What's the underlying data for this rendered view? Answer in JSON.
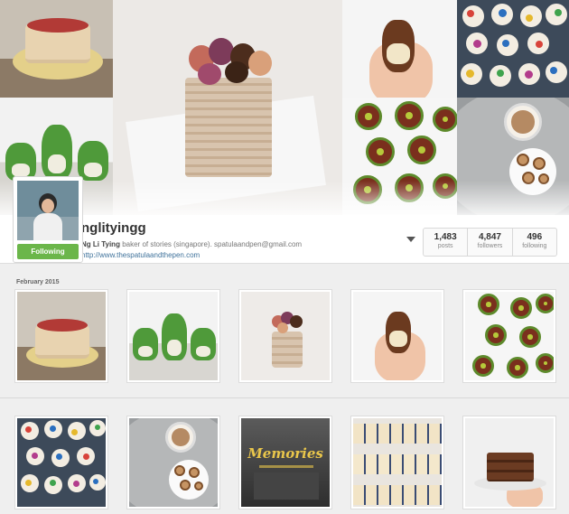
{
  "profile": {
    "username": "nglityingg",
    "full_name": "Ng Li Tying",
    "bio": "baker of stories (singapore). spatulaandpen@gmail.com",
    "website": "http://www.thespatulaandthepen.com",
    "follow_button_label": "Following",
    "follow_button_color": "#6bb64a",
    "stats": [
      {
        "value": "1,483",
        "label": "posts"
      },
      {
        "value": "4,847",
        "label": "followers"
      },
      {
        "value": "496",
        "label": "following"
      }
    ]
  },
  "feed": {
    "month_label": "February 2015",
    "memories_caption": "Memories"
  },
  "colors": {
    "link": "#3f729b",
    "background": "#efefef"
  }
}
